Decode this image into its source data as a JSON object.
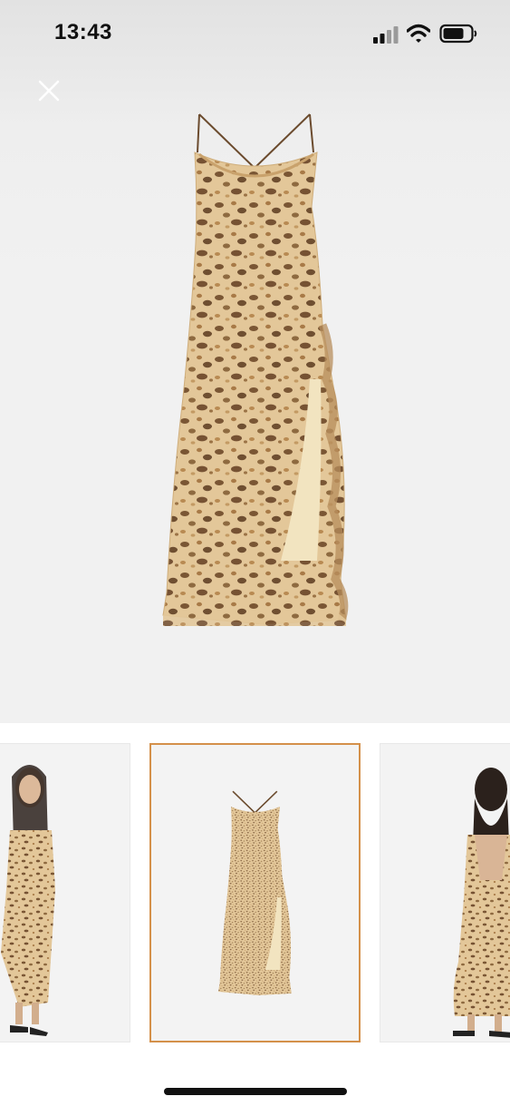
{
  "status_bar": {
    "time": "13:43",
    "icons": [
      "cellular-signal-icon",
      "wifi-icon",
      "battery-icon"
    ]
  },
  "viewer": {
    "close_icon": "close-icon",
    "main_image": "leopard-print-slip-dress-product-image"
  },
  "thumbnails": [
    {
      "name": "model-front-view",
      "selected": false
    },
    {
      "name": "dress-product-view",
      "selected": true
    },
    {
      "name": "model-back-view",
      "selected": false
    }
  ],
  "colors": {
    "selected_border": "#d4904a",
    "viewer_background": "#f1f1f1",
    "dress_base": "#e3c89a",
    "dress_spots": "#7d5a36"
  }
}
